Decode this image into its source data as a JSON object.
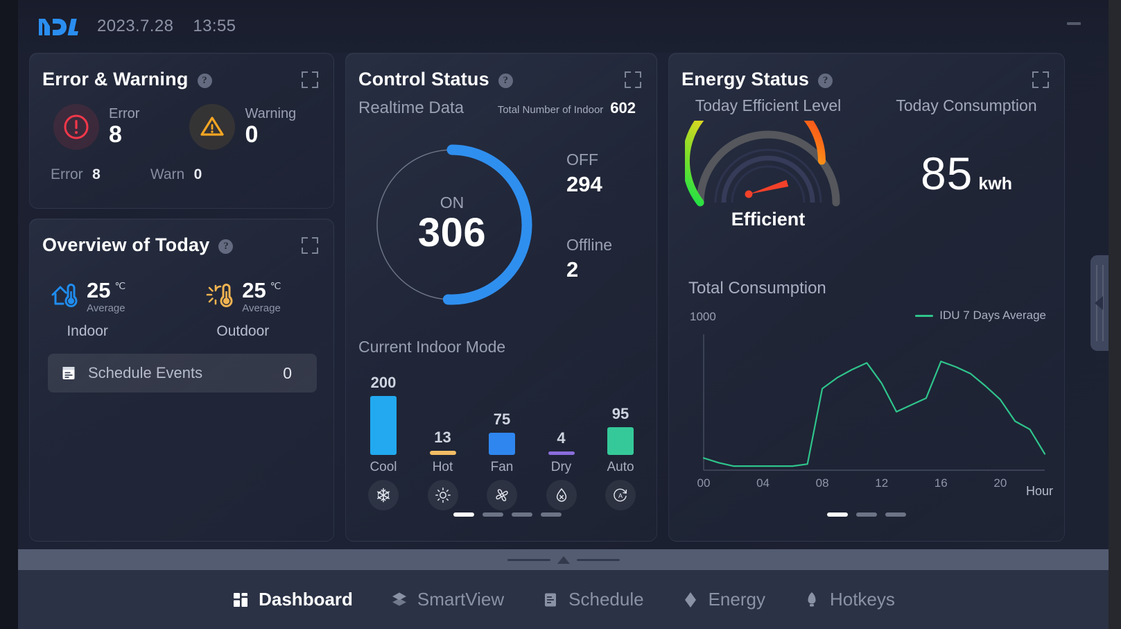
{
  "topbar": {
    "logo": "mdv-logo",
    "date": "2023.7.28",
    "time": "13:55",
    "minimize_label": "minimize"
  },
  "colors": {
    "accent_blue": "#2f9cf4",
    "error_red": "#f5384a",
    "warning_amber": "#f5a623",
    "cool_blue": "#22a9f0",
    "hot_amber": "#f3bd65",
    "fan_blue": "#2f86ee",
    "dry_purple": "#8a6ddb",
    "auto_green": "#35c999",
    "line_green": "#2fc48c",
    "panel_bg": "#2b3145"
  },
  "error_panel": {
    "title": "Error & Warning",
    "help": "?",
    "items": [
      {
        "icon": "error-circle-icon",
        "label": "Error",
        "value": "8"
      },
      {
        "icon": "warning-triangle-icon",
        "label": "Warning",
        "value": "0"
      }
    ],
    "footer": [
      {
        "label": "Error",
        "value": "8"
      },
      {
        "label": "Warn",
        "value": "0"
      }
    ]
  },
  "overview_panel": {
    "title": "Overview of Today",
    "help": "?",
    "metrics": [
      {
        "icon": "house-thermometer-icon",
        "value": "25",
        "unit": "℃",
        "sub": "Average",
        "name": "Indoor"
      },
      {
        "icon": "sun-thermometer-icon",
        "value": "25",
        "unit": "℃",
        "sub": "Average",
        "name": "Outdoor"
      }
    ],
    "schedule": {
      "icon": "calendar-icon",
      "label": "Schedule Events",
      "value": "0"
    }
  },
  "control_panel": {
    "title": "Control Status",
    "help": "?",
    "subtitle": "Realtime Data",
    "total_label": "Total Number of Indoor",
    "total_value": "602",
    "donut": {
      "center_label": "ON",
      "center_value": "306",
      "on": 306,
      "off": 294,
      "offline": 2,
      "total": 602
    },
    "side_stats": [
      {
        "label": "OFF",
        "value": "294"
      },
      {
        "label": "Offline",
        "value": "2"
      }
    ],
    "mode_title": "Current Indoor Mode",
    "modes": [
      {
        "name": "Cool",
        "value": 200,
        "icon": "snowflake-icon",
        "color": "#22a9f0"
      },
      {
        "name": "Hot",
        "value": 13,
        "icon": "sun-icon",
        "color": "#f3bd65"
      },
      {
        "name": "Fan",
        "value": 75,
        "icon": "fan-icon",
        "color": "#2f86ee"
      },
      {
        "name": "Dry",
        "value": 4,
        "icon": "droplet-x-icon",
        "color": "#8a6ddb"
      },
      {
        "name": "Auto",
        "value": 95,
        "icon": "auto-a-icon",
        "color": "#35c999"
      }
    ],
    "pager": {
      "count": 4,
      "active": 0
    }
  },
  "energy_panel": {
    "title": "Energy Status",
    "help": "?",
    "gauge": {
      "heading": "Today Efficient Level",
      "status": "Efficient",
      "needle_fraction": 0.79
    },
    "consumption": {
      "heading": "Today Consumption",
      "value": "85",
      "unit": "kwh"
    },
    "pager": {
      "count": 3,
      "active": 0
    },
    "chart_data": {
      "type": "line",
      "title": "Total Consumption",
      "xlabel": "Hour",
      "ylabel": "",
      "ylim": [
        0,
        1000
      ],
      "ytick_labels": [
        "1000"
      ],
      "xtick_labels": [
        "00",
        "04",
        "08",
        "12",
        "16",
        "20"
      ],
      "grid": false,
      "legend": {
        "position": "top-right",
        "entries": [
          "IDU 7 Days Average"
        ]
      },
      "series": [
        {
          "name": "IDU 7 Days Average",
          "color": "#2fc48c",
          "x": [
            0,
            1,
            2,
            3,
            4,
            5,
            6,
            7,
            8,
            9,
            10,
            11,
            12,
            13,
            14,
            15,
            16,
            17,
            18,
            19,
            20,
            21,
            22,
            23
          ],
          "values": [
            90,
            55,
            30,
            30,
            30,
            30,
            30,
            45,
            600,
            680,
            740,
            790,
            640,
            430,
            480,
            530,
            800,
            760,
            710,
            620,
            520,
            360,
            300,
            120
          ]
        }
      ]
    }
  },
  "side_tabs": [
    {
      "name": "left-panel-toggle",
      "direction": "right"
    },
    {
      "name": "right-panel-toggle",
      "direction": "left"
    }
  ],
  "bottom_nav": {
    "items": [
      {
        "label": "Dashboard",
        "icon": "dashboard-icon",
        "active": true
      },
      {
        "label": "SmartView",
        "icon": "smartview-icon",
        "active": false
      },
      {
        "label": "Schedule",
        "icon": "schedule-icon",
        "active": false
      },
      {
        "label": "Energy",
        "icon": "energy-icon",
        "active": false
      },
      {
        "label": "Hotkeys",
        "icon": "hotkeys-icon",
        "active": false
      }
    ]
  }
}
